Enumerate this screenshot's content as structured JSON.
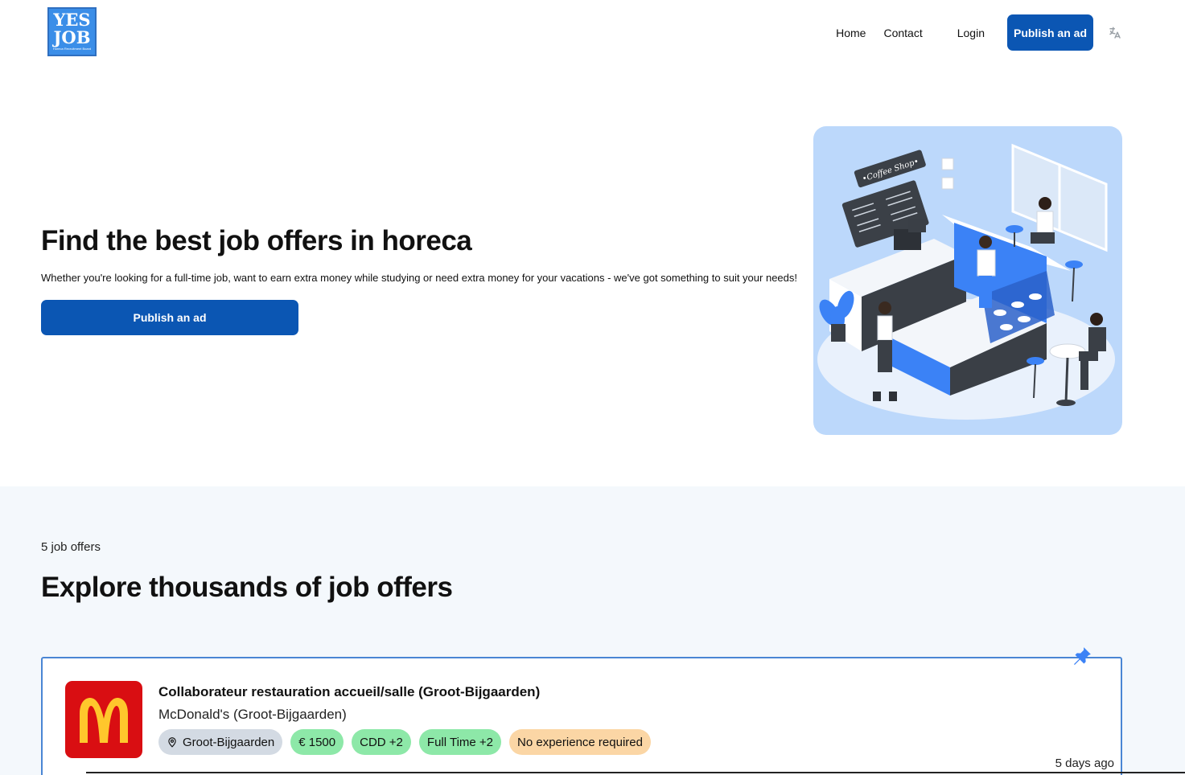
{
  "header": {
    "logo_line1": "YES",
    "logo_line2": "JOB",
    "logo_tagline": "Horeca Recruitment Board",
    "nav": {
      "home": "Home",
      "contact": "Contact",
      "login": "Login",
      "publish": "Publish an ad"
    },
    "lang_icon": "translate-icon"
  },
  "hero": {
    "title": "Find the best job offers in horeca",
    "description": "Whether you're looking for a full-time job, want to earn extra money while studying or need extra money for your vacations - we've got something to suit your needs!",
    "button": "Publish an ad",
    "illustration_sign": "•Coffee Shop•"
  },
  "listings": {
    "count": "5 job offers",
    "title": "Explore thousands of job offers",
    "jobs": [
      {
        "title": "Collaborateur restauration accueil/salle (Groot-Bijgaarden)",
        "company": "McDonald's (Groot-Bijgaarden)",
        "tags": {
          "location": "Groot-Bijgaarden",
          "salary": "€ 1500",
          "contract": "CDD +2",
          "schedule": "Full Time +2",
          "experience": "No experience required"
        },
        "posted": "5 days ago",
        "pinned": true
      }
    ]
  },
  "colors": {
    "primary": "#0b56b3",
    "section_bg": "#f4f8fc",
    "card_border": "#4a86d4",
    "tag_green": "#8de8a8",
    "tag_orange": "#fbd6a5",
    "tag_gray": "#d3dae3",
    "mcdonalds_red": "#d90e12",
    "mcdonalds_yellow": "#ffc72c"
  }
}
